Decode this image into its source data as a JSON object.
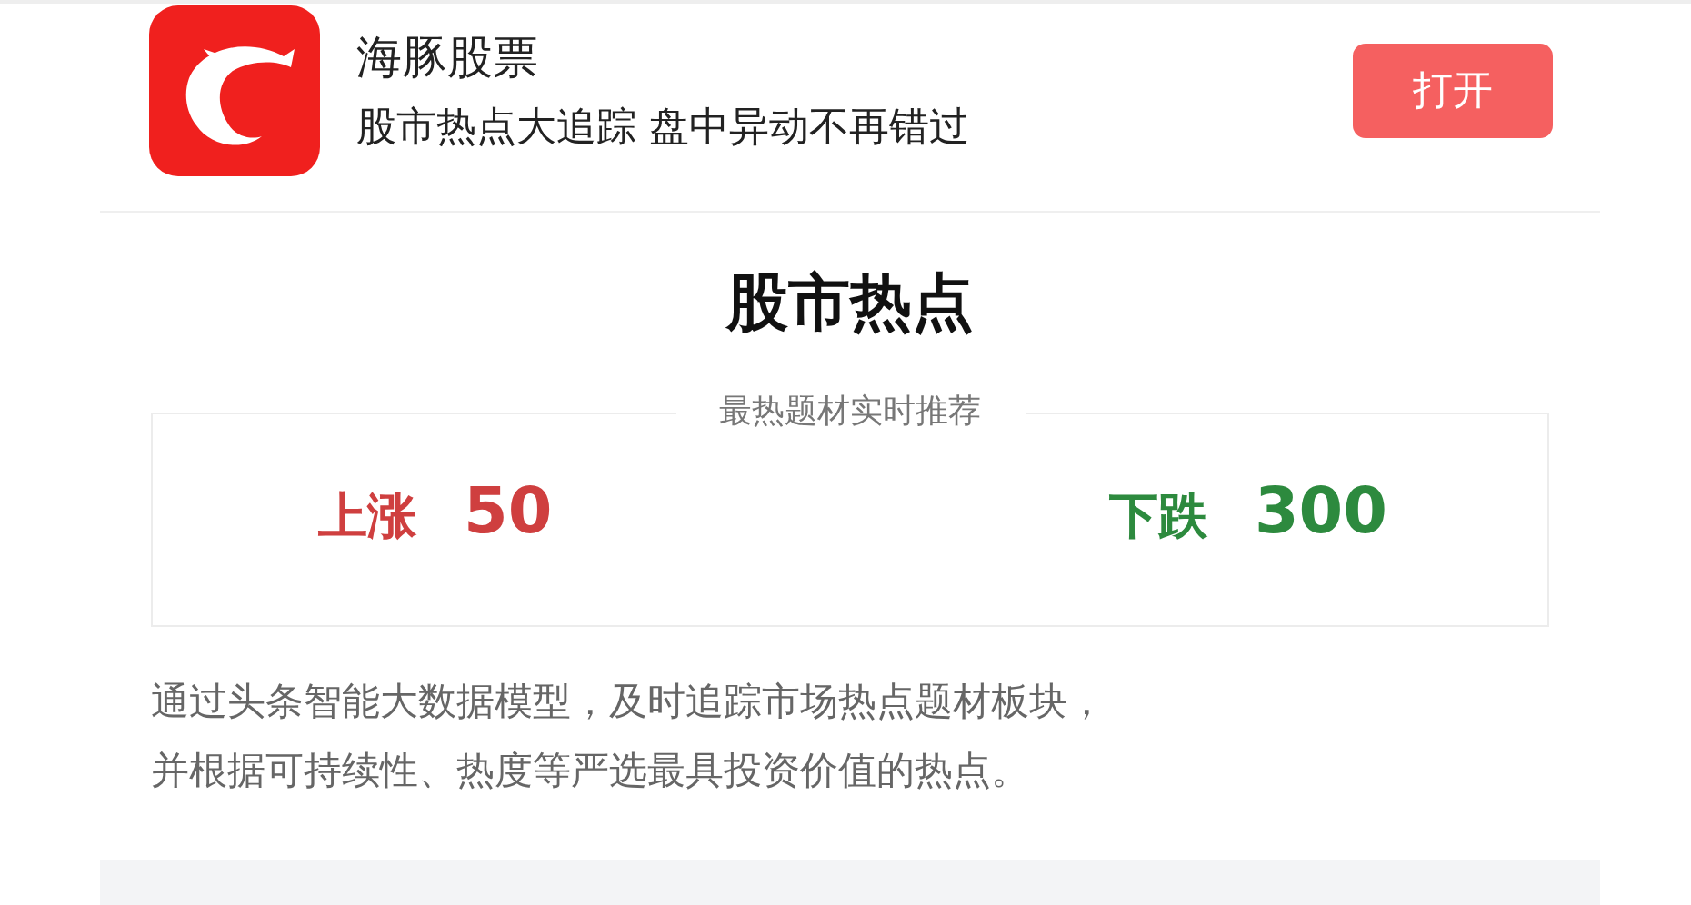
{
  "app": {
    "name": "海豚股票",
    "tagline": "股市热点大追踪 盘中异动不再错过",
    "button": "打开"
  },
  "section": {
    "title": "股市热点",
    "subtitle": "最热题材实时推荐",
    "stats": [
      {
        "label": "上涨",
        "value": "50",
        "color": "#cf3f3f"
      },
      {
        "label": "下跌",
        "value": "300",
        "color": "#2d8a3e"
      }
    ],
    "description_lines": [
      "通过头条智能大数据模型，及时追踪市场热点题材板块，",
      "并根据可持续性、热度等严选最具投资价值的热点。"
    ]
  }
}
